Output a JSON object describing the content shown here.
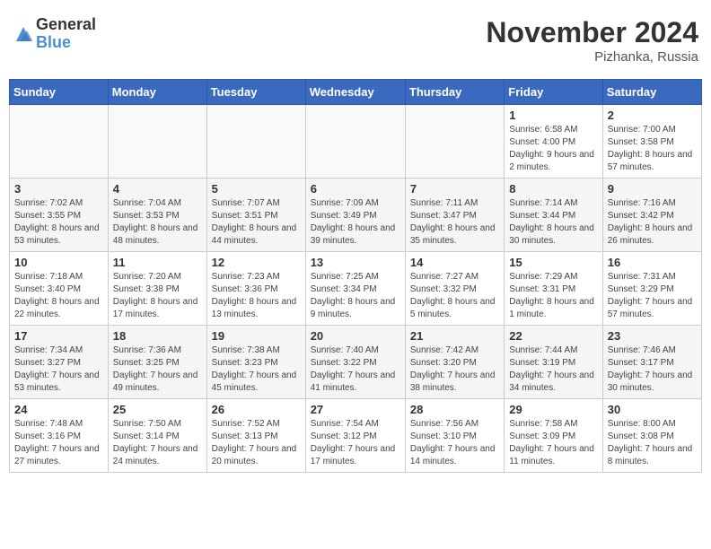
{
  "header": {
    "logo_general": "General",
    "logo_blue": "Blue",
    "month_title": "November 2024",
    "location": "Pizhanka, Russia"
  },
  "days_of_week": [
    "Sunday",
    "Monday",
    "Tuesday",
    "Wednesday",
    "Thursday",
    "Friday",
    "Saturday"
  ],
  "weeks": [
    [
      {
        "day": "",
        "info": ""
      },
      {
        "day": "",
        "info": ""
      },
      {
        "day": "",
        "info": ""
      },
      {
        "day": "",
        "info": ""
      },
      {
        "day": "",
        "info": ""
      },
      {
        "day": "1",
        "info": "Sunrise: 6:58 AM\nSunset: 4:00 PM\nDaylight: 9 hours and 2 minutes."
      },
      {
        "day": "2",
        "info": "Sunrise: 7:00 AM\nSunset: 3:58 PM\nDaylight: 8 hours and 57 minutes."
      }
    ],
    [
      {
        "day": "3",
        "info": "Sunrise: 7:02 AM\nSunset: 3:55 PM\nDaylight: 8 hours and 53 minutes."
      },
      {
        "day": "4",
        "info": "Sunrise: 7:04 AM\nSunset: 3:53 PM\nDaylight: 8 hours and 48 minutes."
      },
      {
        "day": "5",
        "info": "Sunrise: 7:07 AM\nSunset: 3:51 PM\nDaylight: 8 hours and 44 minutes."
      },
      {
        "day": "6",
        "info": "Sunrise: 7:09 AM\nSunset: 3:49 PM\nDaylight: 8 hours and 39 minutes."
      },
      {
        "day": "7",
        "info": "Sunrise: 7:11 AM\nSunset: 3:47 PM\nDaylight: 8 hours and 35 minutes."
      },
      {
        "day": "8",
        "info": "Sunrise: 7:14 AM\nSunset: 3:44 PM\nDaylight: 8 hours and 30 minutes."
      },
      {
        "day": "9",
        "info": "Sunrise: 7:16 AM\nSunset: 3:42 PM\nDaylight: 8 hours and 26 minutes."
      }
    ],
    [
      {
        "day": "10",
        "info": "Sunrise: 7:18 AM\nSunset: 3:40 PM\nDaylight: 8 hours and 22 minutes."
      },
      {
        "day": "11",
        "info": "Sunrise: 7:20 AM\nSunset: 3:38 PM\nDaylight: 8 hours and 17 minutes."
      },
      {
        "day": "12",
        "info": "Sunrise: 7:23 AM\nSunset: 3:36 PM\nDaylight: 8 hours and 13 minutes."
      },
      {
        "day": "13",
        "info": "Sunrise: 7:25 AM\nSunset: 3:34 PM\nDaylight: 8 hours and 9 minutes."
      },
      {
        "day": "14",
        "info": "Sunrise: 7:27 AM\nSunset: 3:32 PM\nDaylight: 8 hours and 5 minutes."
      },
      {
        "day": "15",
        "info": "Sunrise: 7:29 AM\nSunset: 3:31 PM\nDaylight: 8 hours and 1 minute."
      },
      {
        "day": "16",
        "info": "Sunrise: 7:31 AM\nSunset: 3:29 PM\nDaylight: 7 hours and 57 minutes."
      }
    ],
    [
      {
        "day": "17",
        "info": "Sunrise: 7:34 AM\nSunset: 3:27 PM\nDaylight: 7 hours and 53 minutes."
      },
      {
        "day": "18",
        "info": "Sunrise: 7:36 AM\nSunset: 3:25 PM\nDaylight: 7 hours and 49 minutes."
      },
      {
        "day": "19",
        "info": "Sunrise: 7:38 AM\nSunset: 3:23 PM\nDaylight: 7 hours and 45 minutes."
      },
      {
        "day": "20",
        "info": "Sunrise: 7:40 AM\nSunset: 3:22 PM\nDaylight: 7 hours and 41 minutes."
      },
      {
        "day": "21",
        "info": "Sunrise: 7:42 AM\nSunset: 3:20 PM\nDaylight: 7 hours and 38 minutes."
      },
      {
        "day": "22",
        "info": "Sunrise: 7:44 AM\nSunset: 3:19 PM\nDaylight: 7 hours and 34 minutes."
      },
      {
        "day": "23",
        "info": "Sunrise: 7:46 AM\nSunset: 3:17 PM\nDaylight: 7 hours and 30 minutes."
      }
    ],
    [
      {
        "day": "24",
        "info": "Sunrise: 7:48 AM\nSunset: 3:16 PM\nDaylight: 7 hours and 27 minutes."
      },
      {
        "day": "25",
        "info": "Sunrise: 7:50 AM\nSunset: 3:14 PM\nDaylight: 7 hours and 24 minutes."
      },
      {
        "day": "26",
        "info": "Sunrise: 7:52 AM\nSunset: 3:13 PM\nDaylight: 7 hours and 20 minutes."
      },
      {
        "day": "27",
        "info": "Sunrise: 7:54 AM\nSunset: 3:12 PM\nDaylight: 7 hours and 17 minutes."
      },
      {
        "day": "28",
        "info": "Sunrise: 7:56 AM\nSunset: 3:10 PM\nDaylight: 7 hours and 14 minutes."
      },
      {
        "day": "29",
        "info": "Sunrise: 7:58 AM\nSunset: 3:09 PM\nDaylight: 7 hours and 11 minutes."
      },
      {
        "day": "30",
        "info": "Sunrise: 8:00 AM\nSunset: 3:08 PM\nDaylight: 7 hours and 8 minutes."
      }
    ]
  ]
}
